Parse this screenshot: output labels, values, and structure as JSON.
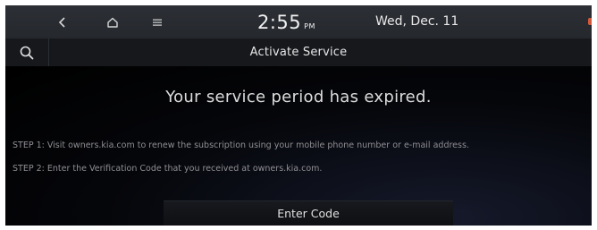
{
  "status_bar": {
    "icons": [
      "back-icon",
      "home-icon",
      "menu-icon"
    ],
    "time": "2:55",
    "ampm": "PM",
    "date": "Wed, Dec. 11"
  },
  "title_bar": {
    "search_icon": "search-icon",
    "title": "Activate Service"
  },
  "content": {
    "headline": "Your service period has expired.",
    "steps": [
      "STEP 1: Visit owners.kia.com to renew the subscription using your mobile phone number or e-mail address.",
      "STEP 2: Enter the Verification Code that you received at owners.kia.com."
    ],
    "enter_code_label": "Enter Code"
  },
  "colors": {
    "background": "#000000",
    "status_bar": "#2a2d32",
    "title_bar": "#16181c",
    "text_primary": "#e6e6e6",
    "text_secondary": "#8f8f93",
    "edge_accent": "#d25a3c"
  }
}
